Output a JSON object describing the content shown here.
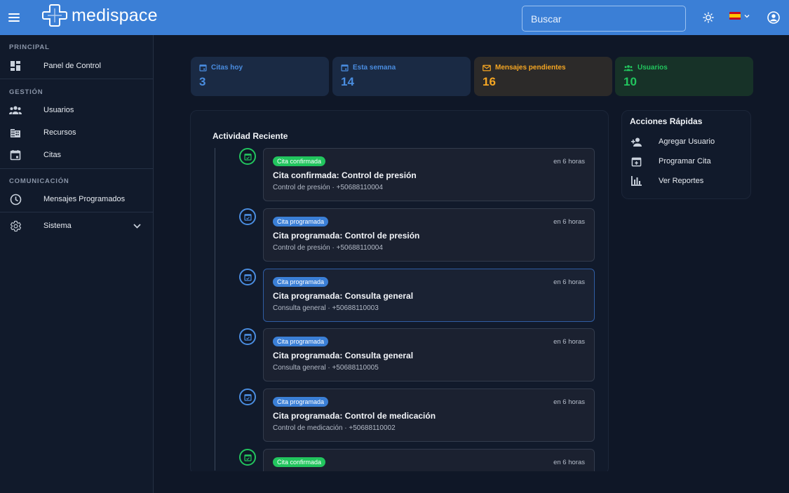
{
  "app": {
    "name": "medispace",
    "search_placeholder": "Buscar"
  },
  "sidebar": {
    "sections": [
      {
        "title": "PRINCIPAL",
        "items": [
          {
            "label": "Panel de Control",
            "icon": "dashboard-icon"
          }
        ]
      },
      {
        "title": "GESTIÓN",
        "items": [
          {
            "label": "Usuarios",
            "icon": "users-icon"
          },
          {
            "label": "Recursos",
            "icon": "building-icon"
          },
          {
            "label": "Citas",
            "icon": "calendar-icon"
          }
        ]
      },
      {
        "title": "COMUNICACIÓN",
        "items": [
          {
            "label": "Mensajes Programados",
            "icon": "clock-icon"
          }
        ]
      }
    ],
    "system": {
      "label": "Sistema",
      "icon": "gear-icon"
    }
  },
  "stats": [
    {
      "label": "Citas hoy",
      "value": "3",
      "color": "#4a8de0",
      "icon": "calendar-icon"
    },
    {
      "label": "Esta semana",
      "value": "14",
      "color": "#4a8de0",
      "icon": "calendar-icon"
    },
    {
      "label": "Mensajes pendientes",
      "value": "16",
      "color": "#f5a623",
      "icon": "mail-icon"
    },
    {
      "label": "Usuarios",
      "value": "10",
      "color": "#22c55e",
      "icon": "users-icon"
    }
  ],
  "activity": {
    "title": "Actividad Reciente",
    "items": [
      {
        "badge": "Cita confirmada",
        "status": "green",
        "time": "en 6 horas",
        "title": "Cita confirmada: Control de presión",
        "subtitle": "Control de presión · +50688110004"
      },
      {
        "badge": "Cita programada",
        "status": "blue",
        "time": "en 6 horas",
        "title": "Cita programada: Control de presión",
        "subtitle": "Control de presión · +50688110004"
      },
      {
        "badge": "Cita programada",
        "status": "blue",
        "time": "en 6 horas",
        "title": "Cita programada: Consulta general",
        "subtitle": "Consulta general · +50688110003"
      },
      {
        "badge": "Cita programada",
        "status": "blue",
        "time": "en 6 horas",
        "title": "Cita programada: Consulta general",
        "subtitle": "Consulta general · +50688110005"
      },
      {
        "badge": "Cita programada",
        "status": "blue",
        "time": "en 6 horas",
        "title": "Cita programada: Control de medicación",
        "subtitle": "Control de medicación · +50688110002"
      },
      {
        "badge": "Cita confirmada",
        "status": "green",
        "time": "en 6 horas",
        "title": "",
        "subtitle": ""
      }
    ]
  },
  "quick_actions": {
    "title": "Acciones Rápidas",
    "items": [
      {
        "label": "Agregar Usuario",
        "icon": "add-user-icon"
      },
      {
        "label": "Programar Cita",
        "icon": "calendar-add-icon"
      },
      {
        "label": "Ver Reportes",
        "icon": "bar-chart-icon"
      }
    ]
  },
  "colors": {
    "topbar": "#3b7fd6",
    "background": "#0f1727",
    "confirmed": "#22c55e",
    "scheduled": "#3b7fd6"
  }
}
